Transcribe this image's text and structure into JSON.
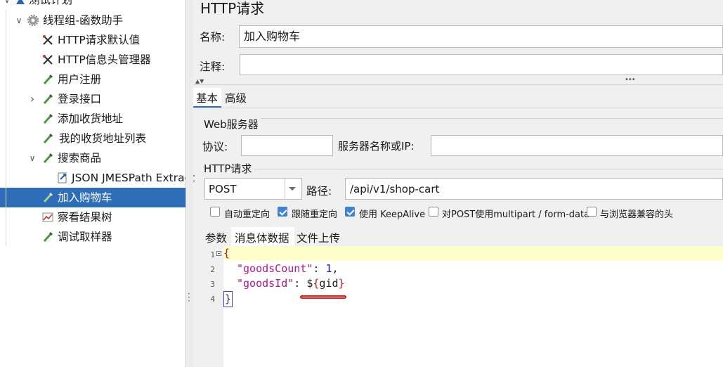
{
  "tree": {
    "items": [
      {
        "label": "测试计划",
        "icon": "test-plan-icon",
        "toggle": "∨"
      },
      {
        "label": "线程组-函数助手",
        "icon": "gear-icon",
        "toggle": "∨"
      },
      {
        "label": "HTTP请求默认值",
        "icon": "wrench-icon",
        "toggle": ""
      },
      {
        "label": "HTTP信息头管理器",
        "icon": "wrench-icon",
        "toggle": ""
      },
      {
        "label": "用户注册",
        "icon": "pipette-icon",
        "toggle": ""
      },
      {
        "label": "登录接口",
        "icon": "pipette-icon",
        "toggle": "›"
      },
      {
        "label": "添加收货地址",
        "icon": "pipette-icon",
        "toggle": ""
      },
      {
        "label": "我的收货地址列表",
        "icon": "pipette-icon",
        "toggle": ""
      },
      {
        "label": "搜索商品",
        "icon": "pipette-icon",
        "toggle": "∨"
      },
      {
        "label": "JSON JMESPath Extract",
        "icon": "extractor-icon",
        "toggle": ""
      },
      {
        "label": "加入购物车",
        "icon": "pipette-icon",
        "toggle": "",
        "selected": true
      },
      {
        "label": "察看结果树",
        "icon": "chart-icon",
        "toggle": ""
      },
      {
        "label": "调试取样器",
        "icon": "pipette-icon",
        "toggle": ""
      }
    ]
  },
  "panel": {
    "title": "HTTP请求",
    "name_label": "名称:",
    "name_value": "加入购物车",
    "comment_label": "注释:",
    "comment_value": "",
    "tabs": {
      "basic": "基本",
      "advanced": "高级"
    },
    "web_server": {
      "legend": "Web服务器",
      "protocol_label": "协议:",
      "protocol_value": "",
      "server_label": "服务器名称或IP:",
      "server_value": ""
    },
    "http_request": {
      "legend": "HTTP请求",
      "method": "POST",
      "path_label": "路径:",
      "path_value": "/api/v1/shop-cart"
    },
    "options": [
      {
        "label": "自动重定向",
        "checked": false
      },
      {
        "label": "跟随重定向",
        "checked": true
      },
      {
        "label": "使用 KeepAlive",
        "checked": true
      },
      {
        "label": "对POST使用multipart / form-data",
        "checked": false
      },
      {
        "label": "与浏览器兼容的头",
        "checked": false
      }
    ],
    "subtabs": {
      "params": "参数",
      "body": "消息体数据",
      "files": "文件上传"
    }
  },
  "editor": {
    "line_numbers": [
      "1",
      "2",
      "3",
      "4"
    ],
    "lines": {
      "l1_brace": "{",
      "l2_key": "\"goodsCount\"",
      "l2_colon": ": ",
      "l2_value": "1",
      "l2_comma": ",",
      "l3_key": "\"goodsId\"",
      "l3_colon": ": ",
      "l3_dollar": "$",
      "l3_open": "{",
      "l3_var": "gid",
      "l3_close": "}",
      "l4_brace": "}"
    },
    "highlight_color": "#ffffcc",
    "annotation_color": "#e01b1b"
  }
}
